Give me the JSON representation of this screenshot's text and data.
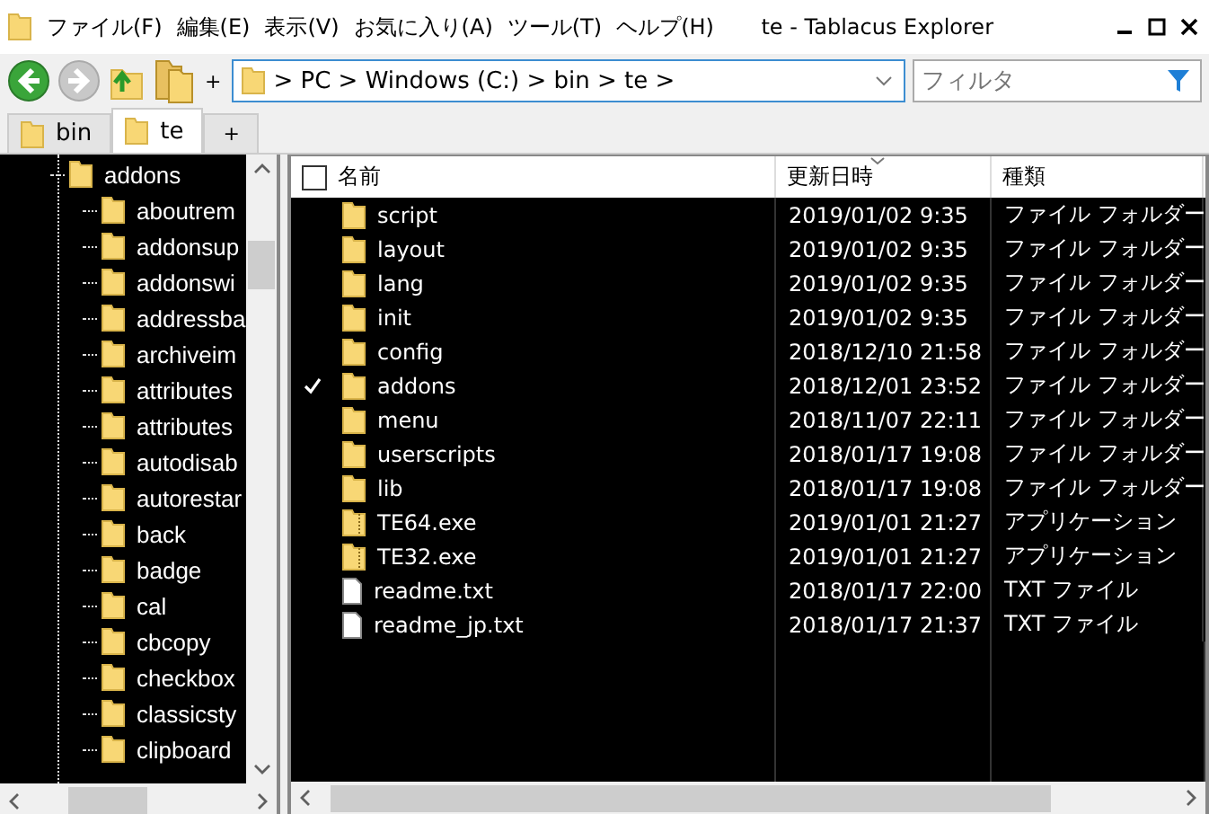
{
  "window": {
    "title": "te - Tablacus Explorer"
  },
  "menu_bar": [
    "ファイル(F)",
    "編集(E)",
    "表示(V)",
    "お気に入り(A)",
    "ツール(T)",
    "ヘルプ(H)"
  ],
  "toolbar": {
    "back_disabled": false,
    "forward_disabled": true,
    "add_label": "+"
  },
  "address": {
    "path": "> PC > Windows (C:) > bin > te >"
  },
  "filter": {
    "placeholder": "フィルタ"
  },
  "tabs": [
    {
      "label": "bin",
      "selected": false
    },
    {
      "label": "te",
      "selected": true
    }
  ],
  "new_tab": "+",
  "tree": [
    {
      "label": "addons",
      "selected": false,
      "children": [
        {
          "label": "aboutrem"
        },
        {
          "label": "addonsup"
        },
        {
          "label": "addonswi"
        },
        {
          "label": "addressba"
        },
        {
          "label": "archiveim"
        },
        {
          "label": "attributes"
        },
        {
          "label": "attributes"
        },
        {
          "label": "autodisab"
        },
        {
          "label": "autorestar"
        },
        {
          "label": "back"
        },
        {
          "label": "badge"
        },
        {
          "label": "cal"
        },
        {
          "label": "cbcopy"
        },
        {
          "label": "checkbox"
        },
        {
          "label": "classicsty"
        },
        {
          "label": "clipboard"
        }
      ]
    }
  ],
  "columns": [
    {
      "label": "名前",
      "sorted": false
    },
    {
      "label": "更新日時",
      "sorted": true
    },
    {
      "label": "種類",
      "sorted": false
    }
  ],
  "header_checked": false,
  "rows": [
    {
      "kind": "folder",
      "name": "script",
      "date": "2019/01/02 9:35",
      "type": "ファイル フォルダー",
      "checked": false
    },
    {
      "kind": "folder",
      "name": "layout",
      "date": "2019/01/02 9:35",
      "type": "ファイル フォルダー",
      "checked": false
    },
    {
      "kind": "folder",
      "name": "lang",
      "date": "2019/01/02 9:35",
      "type": "ファイル フォルダー",
      "checked": false
    },
    {
      "kind": "folder",
      "name": "init",
      "date": "2019/01/02 9:35",
      "type": "ファイル フォルダー",
      "checked": false
    },
    {
      "kind": "folder",
      "name": "config",
      "date": "2018/12/10 21:58",
      "type": "ファイル フォルダー",
      "checked": false
    },
    {
      "kind": "folder",
      "name": "addons",
      "date": "2018/12/01 23:52",
      "type": "ファイル フォルダー",
      "checked": true
    },
    {
      "kind": "folder",
      "name": "menu",
      "date": "2018/11/07 22:11",
      "type": "ファイル フォルダー",
      "checked": false
    },
    {
      "kind": "folder",
      "name": "userscripts",
      "date": "2018/01/17 19:08",
      "type": "ファイル フォルダー",
      "checked": false
    },
    {
      "kind": "folder",
      "name": "lib",
      "date": "2018/01/17 19:08",
      "type": "ファイル フォルダー",
      "checked": false
    },
    {
      "kind": "app",
      "name": "TE64.exe",
      "date": "2019/01/01 21:27",
      "type": "アプリケーション",
      "checked": false
    },
    {
      "kind": "app",
      "name": "TE32.exe",
      "date": "2019/01/01 21:27",
      "type": "アプリケーション",
      "checked": false
    },
    {
      "kind": "text",
      "name": "readme.txt",
      "date": "2018/01/17 22:00",
      "type": "TXT ファイル",
      "checked": false
    },
    {
      "kind": "text",
      "name": "readme_jp.txt",
      "date": "2018/01/17 21:37",
      "type": "TXT ファイル",
      "checked": false
    }
  ]
}
